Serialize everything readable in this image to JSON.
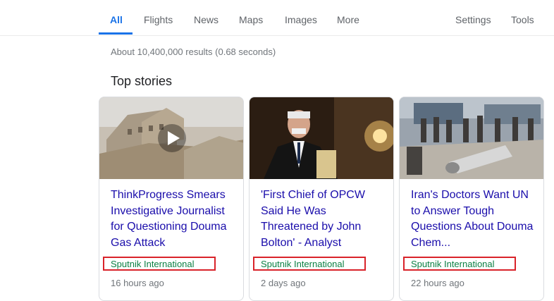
{
  "tabs": {
    "all": "All",
    "flights": "Flights",
    "news": "News",
    "maps": "Maps",
    "images": "Images",
    "more": "More",
    "settings": "Settings",
    "tools": "Tools"
  },
  "result_stats": "About 10,400,000 results (0.68 seconds)",
  "section_title": "Top stories",
  "stories": [
    {
      "headline": "ThinkProgress Smears Investigative Journalist for Questioning Douma Gas Attack",
      "source": "Sputnik International",
      "time": "16 hours ago"
    },
    {
      "headline": "'First Chief of OPCW Said He Was Threatened by John Bolton' - Analyst",
      "source": "Sputnik International",
      "time": "2 days ago"
    },
    {
      "headline": "Iran's Doctors Want UN to Answer Tough Questions About Douma Chem...",
      "source": "Sputnik International",
      "time": "22 hours ago"
    }
  ],
  "colors": {
    "accent": "#1a73e8",
    "headline": "#1a0dab",
    "source": "#0b8043",
    "highlight_box": "#d9232a"
  }
}
